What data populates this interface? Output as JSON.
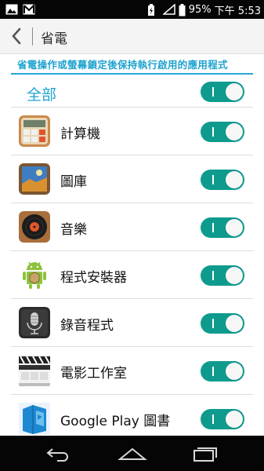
{
  "status_bar": {
    "battery": "95%",
    "time": "下午 5:53",
    "icons": [
      "image-icon",
      "gmail-icon",
      "battery-saver-icon",
      "signal-icon",
      "battery-icon"
    ]
  },
  "action_bar": {
    "title": "省電",
    "back_icon": "back-chevron-icon"
  },
  "section": {
    "header": "省電操作或螢幕鎖定後保持執行啟用的應用程式"
  },
  "all_item": {
    "label": "全部",
    "enabled": true
  },
  "apps": [
    {
      "label": "計算機",
      "icon": "calculator-icon",
      "enabled": true
    },
    {
      "label": "圖庫",
      "icon": "gallery-icon",
      "enabled": true
    },
    {
      "label": "音樂",
      "icon": "music-icon",
      "enabled": true
    },
    {
      "label": "程式安裝器",
      "icon": "android-installer-icon",
      "enabled": true
    },
    {
      "label": "錄音程式",
      "icon": "sound-recorder-icon",
      "enabled": true
    },
    {
      "label": "電影工作室",
      "icon": "movie-studio-icon",
      "enabled": true
    },
    {
      "label": "Google Play 圖書",
      "icon": "play-books-icon",
      "enabled": true
    }
  ],
  "nav_bar": {
    "icons": [
      "back-icon",
      "home-icon",
      "recent-apps-icon"
    ]
  },
  "colors": {
    "accent": "#1fa3cf",
    "toggle_on": "#0e9b8d",
    "status_bar": "#050505"
  }
}
